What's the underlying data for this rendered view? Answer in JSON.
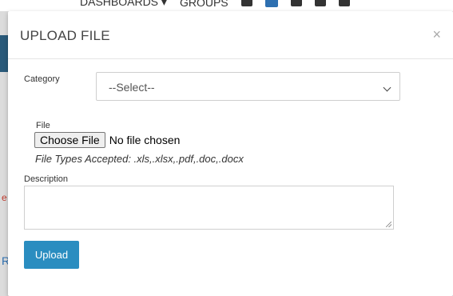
{
  "background": {
    "nav_items": [
      {
        "label": "DASHBOARDS ▾",
        "icon": "dashboard-icon"
      },
      {
        "label": "GROUPS",
        "icon": "groups-icon"
      }
    ],
    "left_fragment_red": "e",
    "left_fragment_blue": "R"
  },
  "modal": {
    "title": "UPLOAD FILE",
    "close_glyph": "×",
    "category": {
      "label": "Category",
      "selected": "--Select--"
    },
    "file": {
      "label": "File",
      "button_label": "Choose File",
      "status": "No file chosen",
      "accepted_types": "File Types Accepted: .xls,.xlsx,.pdf,.doc,.docx"
    },
    "description": {
      "label": "Description",
      "value": ""
    },
    "upload_label": "Upload",
    "colors": {
      "primary_button": "#2a8dc0",
      "header_border": "#e5e5e5"
    }
  }
}
